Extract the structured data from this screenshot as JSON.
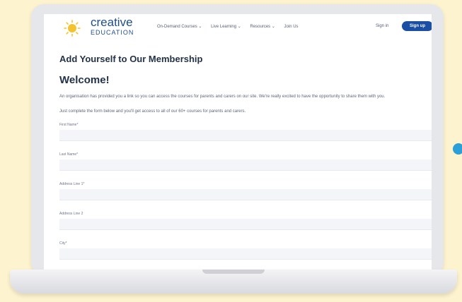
{
  "brand": {
    "name_line1": "creative",
    "name_line2": "EDUCATION",
    "colors": {
      "primary": "#1a4fa3",
      "logo_yellow": "#f2c230",
      "accent_blue": "#2a9fd8"
    }
  },
  "nav": {
    "items": [
      {
        "label": "On-Demand Courses",
        "icon": "chevron-down-icon"
      },
      {
        "label": "Live Learning",
        "icon": "chevron-down-icon"
      },
      {
        "label": "Resources",
        "icon": "chevron-down-icon"
      },
      {
        "label": "Join Us"
      }
    ],
    "signin_label": "Sign in",
    "signup_label": "Sign up"
  },
  "page": {
    "title": "Add Yourself to Our Membership",
    "welcome": "Welcome!",
    "intro": "An organisation has provided you a link so you can access the courses for parents and carers on our site. We're really excited to have the opportunity to share them with you.",
    "instructions": "Just complete the form below and you'll get access to all of our 60+ courses for parents and carers."
  },
  "form": {
    "fields": [
      {
        "label": "First Name*",
        "value": ""
      },
      {
        "label": "Last Name*",
        "value": ""
      },
      {
        "label": "Address Line 1*",
        "value": ""
      },
      {
        "label": "Address Line 2",
        "value": ""
      },
      {
        "label": "City*",
        "value": ""
      }
    ]
  }
}
